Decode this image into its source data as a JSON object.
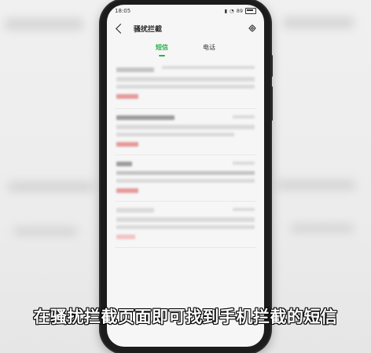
{
  "status_bar": {
    "time": "18:05",
    "battery": "89"
  },
  "header": {
    "title": "骚扰拦截"
  },
  "tabs": [
    {
      "label": "短信",
      "active": true
    },
    {
      "label": "电话",
      "active": false
    }
  ],
  "caption": "在骚扰拦截页面即可找到手机拦截的短信",
  "colors": {
    "accent": "#2bb24c",
    "blocked_tag": "#e49a9a"
  },
  "icons": {
    "back": "chevron-left-icon",
    "settings": "gear-icon"
  }
}
